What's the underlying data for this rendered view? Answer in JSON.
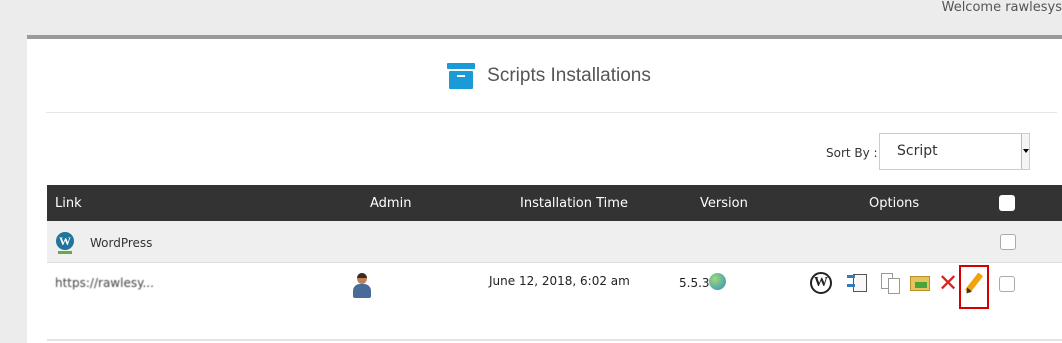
{
  "header": {
    "welcome_text": "Welcome rawlesys"
  },
  "page": {
    "title": "Scripts Installations",
    "title_icon": "archive-box-icon"
  },
  "sort": {
    "label": "Sort By :",
    "selected": "Script"
  },
  "table": {
    "columns": {
      "link": "Link",
      "admin": "Admin",
      "installation_time": "Installation Time",
      "version": "Version",
      "options": "Options"
    },
    "groups": [
      {
        "name": "WordPress",
        "rows": [
          {
            "link": "https://rawlesy...",
            "installation_time": "June 12, 2018, 6:02 am",
            "version": "5.5.3",
            "options": [
              "wordpress-manage-icon",
              "backup-icon",
              "clone-icon",
              "migrate-icon",
              "remove-icon",
              "edit-icon"
            ]
          }
        ]
      }
    ]
  },
  "colors": {
    "accent": "#1a9ad6",
    "table_header": "#333333",
    "highlight": "#d40000",
    "remove": "#d9261c",
    "edit": "#f0a30a"
  }
}
